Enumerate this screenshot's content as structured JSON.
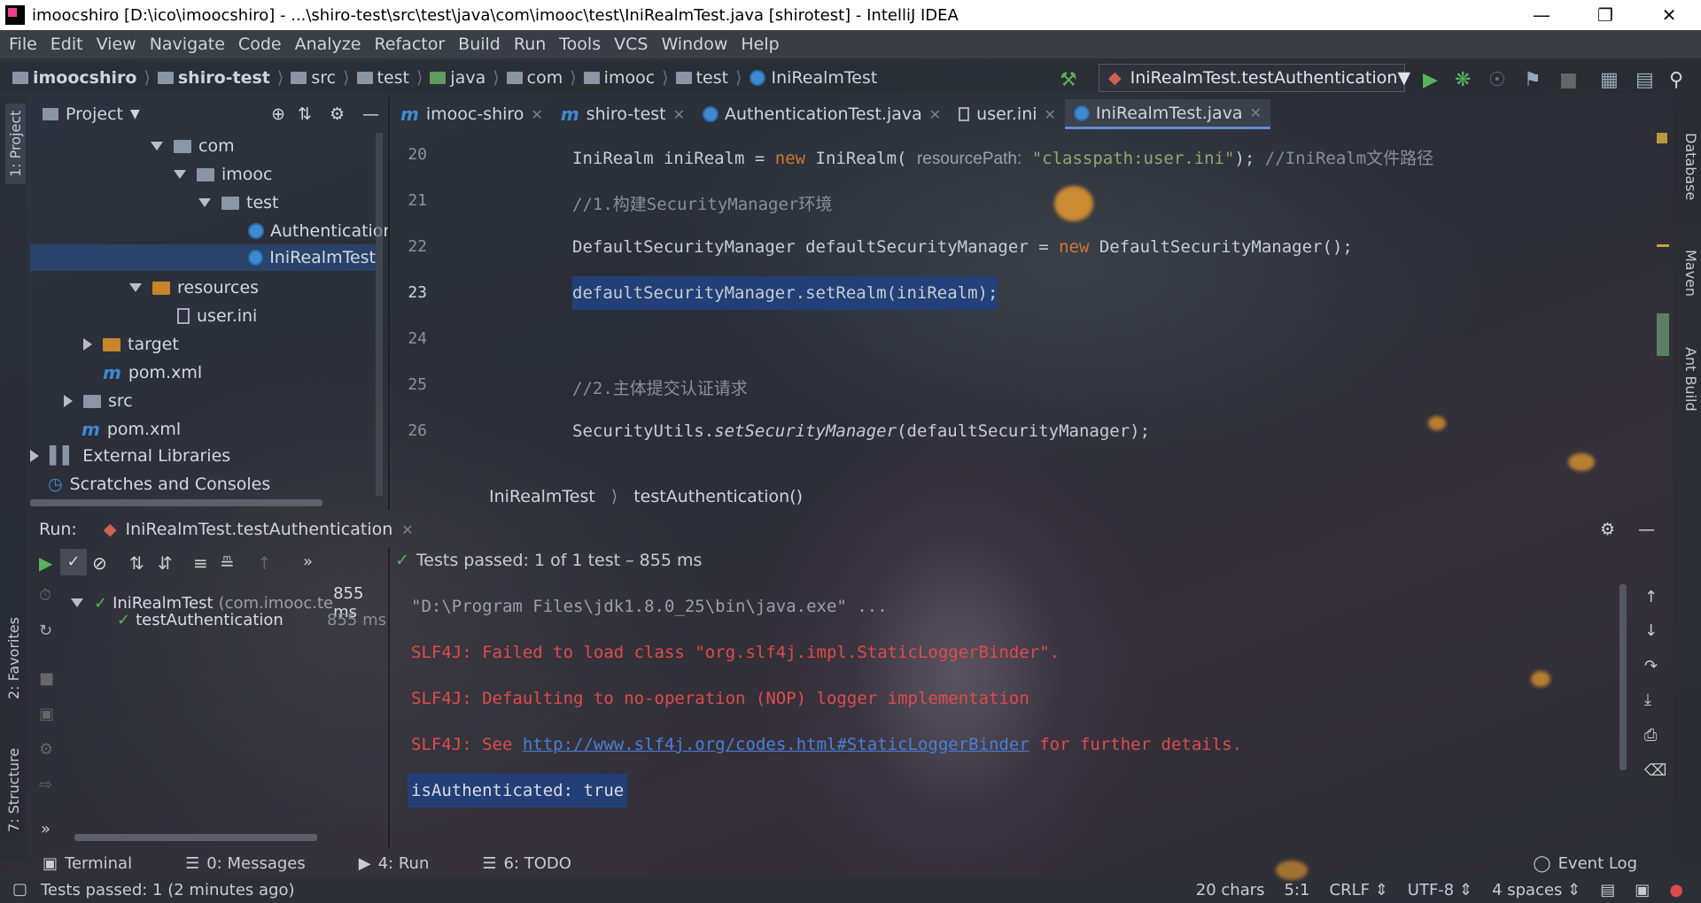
{
  "window": {
    "title": "imoocshiro [D:\\ico\\imoocshiro] - ...\\shiro-test\\src\\test\\java\\com\\imooc\\test\\IniRealmTest.java [shirotest] - IntelliJ IDEA"
  },
  "menu": [
    "File",
    "Edit",
    "View",
    "Navigate",
    "Code",
    "Analyze",
    "Refactor",
    "Build",
    "Run",
    "Tools",
    "VCS",
    "Window",
    "Help"
  ],
  "breadcrumb": [
    "imoocshiro",
    "shiro-test",
    "src",
    "test",
    "java",
    "com",
    "imooc",
    "test",
    "IniRealmTest"
  ],
  "run_config": "IniRealmTest.testAuthentication",
  "left_stripe": {
    "project": "1: Project",
    "favorites": "2: Favorites",
    "structure": "7: Structure"
  },
  "right_stripe": {
    "database": "Database",
    "maven": "Maven",
    "ant": "Ant Build"
  },
  "project": {
    "header": "Project",
    "tree": [
      "com",
      "imooc",
      "test",
      "Authentication",
      "IniRealmTest",
      "resources",
      "user.ini",
      "target",
      "pom.xml",
      "src",
      "pom.xml",
      "External Libraries",
      "Scratches and Consoles"
    ]
  },
  "editor": {
    "tabs": [
      "imooc-shiro",
      "shiro-test",
      "AuthenticationTest.java",
      "user.ini",
      "IniRealmTest.java"
    ],
    "lines": [
      {
        "n": "20"
      },
      {
        "n": "21"
      },
      {
        "n": "22"
      },
      {
        "n": "23"
      },
      {
        "n": "24"
      },
      {
        "n": "25"
      },
      {
        "n": "26"
      }
    ],
    "code": {
      "l20a": "IniRealm iniRealm = ",
      "l20kw": "new",
      "l20b": " IniRealm( ",
      "l20hint": "resourcePath:",
      "l20str": " \"classpath:user.ini\"",
      "l20c": "); ",
      "l20cm": "//IniRealm文件路径",
      "l21": "//1.构建SecurityManager环境",
      "l22a": "DefaultSecurityManager defaultSecurityManager = ",
      "l22kw": "new",
      "l22b": " DefaultSecurityManager();",
      "l23": "defaultSecurityManager.setRealm(iniRealm);",
      "l25": "//2.主体提交认证请求",
      "l26a": "SecurityUtils.",
      "l26it": "setSecurityManager",
      "l26b": "(defaultSecurityManager);"
    },
    "crumb": [
      "IniRealmTest",
      "testAuthentication()"
    ]
  },
  "run": {
    "label": "Run:",
    "tab": "IniRealmTest.testAuthentication",
    "status": "Tests passed: 1 of 1 test – 855 ms",
    "tree": [
      {
        "name": "IniRealmTest",
        "pkg": "(com.imooc.te",
        "time": "855 ms"
      },
      {
        "name": "testAuthentication",
        "time": "855 ms"
      }
    ],
    "console": {
      "l1": "\"D:\\Program Files\\jdk1.8.0_25\\bin\\java.exe\" ...",
      "l2": "SLF4J: Failed to load class \"org.slf4j.impl.StaticLoggerBinder\".",
      "l3": "SLF4J: Defaulting to no-operation (NOP) logger implementation",
      "l4a": "SLF4J: See ",
      "l4link": "http://www.slf4j.org/codes.html#StaticLoggerBinder",
      "l4b": " for further details.",
      "l5": "isAuthenticated: true"
    }
  },
  "bottom_tabs": {
    "terminal": "Terminal",
    "messages": "0: Messages",
    "run": "4: Run",
    "todo": "6: TODO",
    "event_log": "Event Log"
  },
  "status": {
    "left": "Tests passed: 1 (2 minutes ago)",
    "chars": "20 chars",
    "pos": "5:1",
    "crlf": "CRLF",
    "enc": "UTF-8",
    "indent": "4 spaces"
  }
}
